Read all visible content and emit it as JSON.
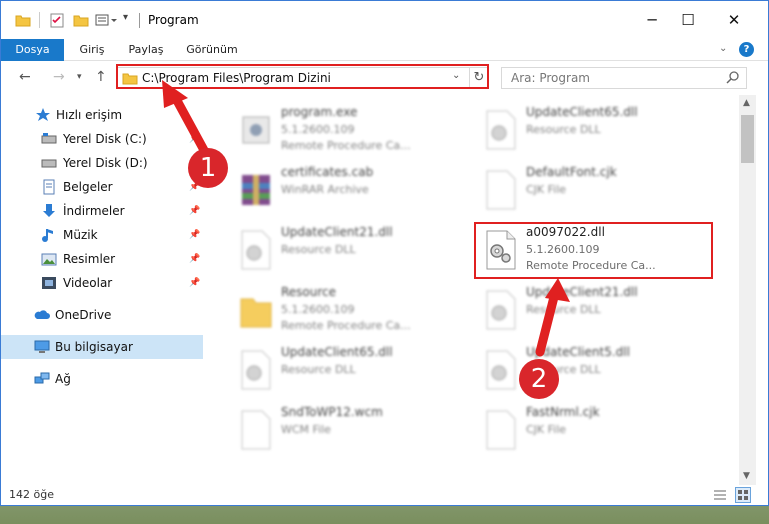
{
  "window": {
    "title": "Program",
    "controls": {
      "minimize": "─",
      "maximize": "☐",
      "close": "✕"
    }
  },
  "ribbon": {
    "tabs": [
      "Dosya",
      "Giriş",
      "Paylaş",
      "Görünüm"
    ],
    "help": "?"
  },
  "address": {
    "path": "C:\\Program Files\\Program Dizini"
  },
  "search": {
    "placeholder": "Ara: Program"
  },
  "sidebar": {
    "items": [
      {
        "label": "Hızlı erişim",
        "icon": "star-icon"
      },
      {
        "label": "Yerel Disk (C:)",
        "icon": "drive-icon",
        "pinned": true
      },
      {
        "label": "Yerel Disk (D:)",
        "icon": "drive-icon",
        "pinned": true
      },
      {
        "label": "Belgeler",
        "icon": "documents-icon",
        "pinned": true
      },
      {
        "label": "İndirmeler",
        "icon": "download-icon",
        "pinned": true
      },
      {
        "label": "Müzik",
        "icon": "music-icon",
        "pinned": true
      },
      {
        "label": "Resimler",
        "icon": "pictures-icon",
        "pinned": true
      },
      {
        "label": "Videolar",
        "icon": "video-icon",
        "pinned": true
      },
      {
        "label": "OneDrive",
        "icon": "cloud-icon"
      },
      {
        "label": "Bu bilgisayar",
        "icon": "computer-icon",
        "selected": true
      },
      {
        "label": "Ağ",
        "icon": "network-icon"
      }
    ]
  },
  "files": [
    {
      "name": "program.exe",
      "line1": "5.1.2600.109",
      "line2": "Remote Procedure Ca...",
      "icon": "exe-icon"
    },
    {
      "name": "UpdateClient65.dll",
      "line1": "Resource DLL",
      "line2": "",
      "icon": "dll-icon"
    },
    {
      "name": "certificates.cab",
      "line1": "WinRAR Archive",
      "line2": "",
      "icon": "archive-icon"
    },
    {
      "name": "DefaultFont.cjk",
      "line1": "CJK File",
      "line2": "",
      "icon": "blank-file-icon"
    },
    {
      "name": "UpdateClient21.dll",
      "line1": "Resource DLL",
      "line2": "",
      "icon": "dll-icon"
    },
    {
      "name": "a0097022.dll",
      "line1": "5.1.2600.109",
      "line2": "Remote Procedure Ca...",
      "icon": "dll-icon"
    },
    {
      "name": "Resource",
      "line1": "5.1.2600.109",
      "line2": "Remote Procedure Ca...",
      "icon": "folder-icon"
    },
    {
      "name": "UpdateClient21.dll",
      "line1": "Resource DLL",
      "line2": "",
      "icon": "dll-icon"
    },
    {
      "name": "UpdateClient65.dll",
      "line1": "Resource DLL",
      "line2": "",
      "icon": "dll-icon"
    },
    {
      "name": "UpdateClient5.dll",
      "line1": "Resource DLL",
      "line2": "",
      "icon": "dll-icon"
    },
    {
      "name": "SndToWP12.wcm",
      "line1": "WCM File",
      "line2": "",
      "icon": "blank-file-icon"
    },
    {
      "name": "FastNrml.cjk",
      "line1": "CJK File",
      "line2": "",
      "icon": "blank-file-icon"
    }
  ],
  "status": {
    "count": "142 öğe"
  },
  "annotations": {
    "badge1": "1",
    "badge2": "2"
  },
  "colors": {
    "accent": "#1979ca",
    "highlight": "#e02020",
    "selected": "#cce4f7"
  }
}
